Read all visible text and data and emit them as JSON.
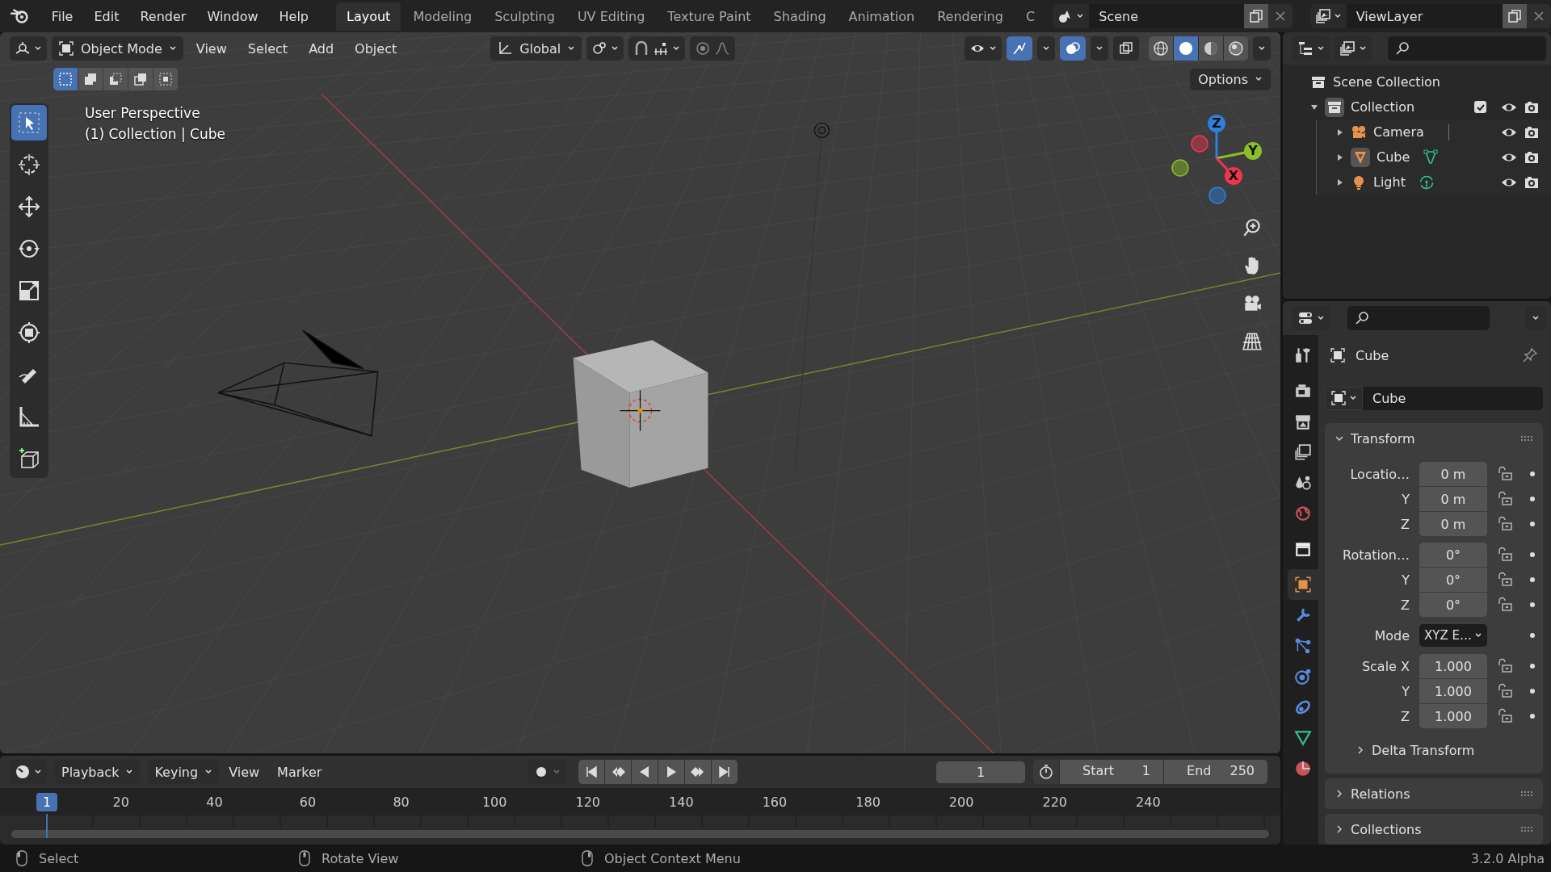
{
  "menus": [
    "File",
    "Edit",
    "Render",
    "Window",
    "Help"
  ],
  "workspace_tabs": [
    {
      "label": "Layout",
      "selected": true
    },
    {
      "label": "Modeling",
      "selected": false
    },
    {
      "label": "Sculpting",
      "selected": false
    },
    {
      "label": "UV Editing",
      "selected": false
    },
    {
      "label": "Texture Paint",
      "selected": false
    },
    {
      "label": "Shading",
      "selected": false
    },
    {
      "label": "Animation",
      "selected": false
    },
    {
      "label": "Rendering",
      "selected": false
    },
    {
      "label": "C",
      "selected": false
    }
  ],
  "scene": {
    "name": "Scene"
  },
  "view_layer": {
    "name": "ViewLayer"
  },
  "viewport": {
    "mode": "Object Mode",
    "menus": [
      "View",
      "Select",
      "Add",
      "Object"
    ],
    "orientation": "Global",
    "options": "Options",
    "toggles": [
      {
        "kind": "gizmo",
        "on": true
      },
      {
        "kind": "overlay",
        "on": true
      },
      {
        "kind": "xray",
        "on": false
      }
    ],
    "shading": [
      {
        "kind": "wireframe",
        "selected": false
      },
      {
        "kind": "solid",
        "selected": true
      },
      {
        "kind": "material",
        "selected": false
      },
      {
        "kind": "rendered",
        "selected": false
      }
    ],
    "select_modes": [
      {
        "kind": "set",
        "selected": true
      },
      {
        "kind": "extend",
        "selected": false
      },
      {
        "kind": "subtract",
        "selected": false
      },
      {
        "kind": "invert",
        "selected": false
      },
      {
        "kind": "intersect",
        "selected": false
      }
    ],
    "tools": [
      {
        "kind": "select",
        "selected": true
      },
      {
        "kind": "cursor",
        "selected": false
      },
      {
        "kind": "move",
        "selected": false
      },
      {
        "kind": "rotate",
        "selected": false
      },
      {
        "kind": "scale",
        "selected": false
      },
      {
        "kind": "transform",
        "selected": false
      },
      {
        "kind": "annotate",
        "selected": false
      },
      {
        "kind": "measure",
        "selected": false
      },
      {
        "kind": "add-cube",
        "selected": false
      }
    ],
    "overlay_lines": [
      "User Perspective",
      "(1) Collection | Cube"
    ],
    "gizmo_axes": [
      {
        "label": "Z",
        "color": "#2f7fe0"
      },
      {
        "label": "Y",
        "color": "#8bbf29"
      },
      {
        "label": "X",
        "color": "#f0364f"
      }
    ]
  },
  "outliner": {
    "root": "Scene Collection",
    "items": [
      {
        "label": "Collection",
        "kind": "collection",
        "expanded": true,
        "checked": true,
        "children": [
          {
            "label": "Camera",
            "kind": "camera",
            "expanded": false
          },
          {
            "label": "Cube",
            "kind": "mesh",
            "expanded": false
          },
          {
            "label": "Light",
            "kind": "light",
            "expanded": false
          }
        ]
      }
    ]
  },
  "properties": {
    "tabs": [
      {
        "kind": "tool",
        "selected": false
      },
      {
        "kind": "render",
        "selected": false
      },
      {
        "kind": "output",
        "selected": false
      },
      {
        "kind": "view-layer",
        "selected": false
      },
      {
        "kind": "scene",
        "selected": false
      },
      {
        "kind": "world",
        "selected": false
      },
      {
        "kind": "collection",
        "selected": false
      },
      {
        "kind": "object",
        "selected": true
      },
      {
        "kind": "modifier",
        "selected": false
      },
      {
        "kind": "particles",
        "selected": false
      },
      {
        "kind": "physics",
        "selected": false
      },
      {
        "kind": "constraints",
        "selected": false
      },
      {
        "kind": "data",
        "selected": false
      },
      {
        "kind": "material",
        "selected": false
      }
    ],
    "object_name": "Cube",
    "datablock": "Cube",
    "panels": [
      {
        "title": "Transform",
        "expanded": true,
        "groups": [
          {
            "rows": [
              {
                "label": "Locatio…",
                "value": "0 m",
                "kind": "number"
              },
              {
                "label": "Y",
                "value": "0 m",
                "kind": "number"
              },
              {
                "label": "Z",
                "value": "0 m",
                "kind": "number"
              }
            ]
          },
          {
            "rows": [
              {
                "label": "Rotation…",
                "value": "0°",
                "kind": "number"
              },
              {
                "label": "Y",
                "value": "0°",
                "kind": "number"
              },
              {
                "label": "Z",
                "value": "0°",
                "kind": "number"
              }
            ]
          },
          {
            "rows": [
              {
                "label": "Mode",
                "value": "XYZ E…",
                "kind": "dropdown"
              }
            ]
          },
          {
            "rows": [
              {
                "label": "Scale X",
                "value": "1.000",
                "kind": "number"
              },
              {
                "label": "Y",
                "value": "1.000",
                "kind": "number"
              },
              {
                "label": "Z",
                "value": "1.000",
                "kind": "number"
              }
            ]
          }
        ],
        "subpanels": [
          {
            "title": "Delta Transform",
            "expanded": false
          }
        ]
      },
      {
        "title": "Relations",
        "expanded": false
      },
      {
        "title": "Collections",
        "expanded": false
      }
    ]
  },
  "timeline": {
    "menus": [
      "Playback",
      "Keying",
      "View",
      "Marker"
    ],
    "current_frame": "1",
    "start_label": "Start",
    "start": "1",
    "end_label": "End",
    "end": "250",
    "ruler": [
      {
        "label": "1",
        "selected": true
      },
      {
        "label": "20",
        "selected": false
      },
      {
        "label": "40",
        "selected": false
      },
      {
        "label": "60",
        "selected": false
      },
      {
        "label": "80",
        "selected": false
      },
      {
        "label": "100",
        "selected": false
      },
      {
        "label": "120",
        "selected": false
      },
      {
        "label": "140",
        "selected": false
      },
      {
        "label": "160",
        "selected": false
      },
      {
        "label": "180",
        "selected": false
      },
      {
        "label": "200",
        "selected": false
      },
      {
        "label": "220",
        "selected": false
      },
      {
        "label": "240",
        "selected": false
      }
    ]
  },
  "status_bar": {
    "hints": [
      "Select",
      "Rotate View",
      "Object Context Menu"
    ],
    "version": "3.2.0 Alpha"
  }
}
